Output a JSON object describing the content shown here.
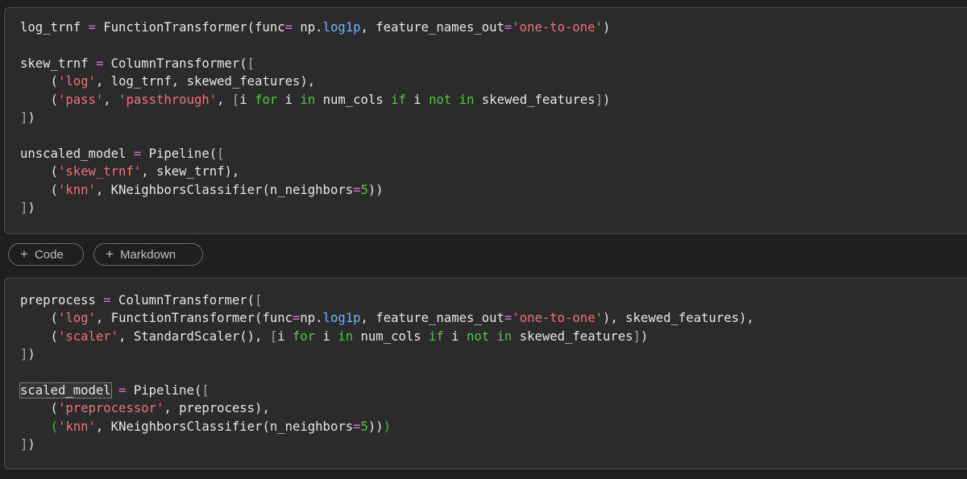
{
  "cells": [
    {
      "lines": [
        [
          [
            "n",
            "log_trnf "
          ],
          [
            "op",
            "="
          ],
          [
            "n",
            " FunctionTransformer(func"
          ],
          [
            "op",
            "="
          ],
          [
            "n",
            " np."
          ],
          [
            "attr",
            "log1p"
          ],
          [
            "n",
            ", feature_names_out"
          ],
          [
            "op",
            "="
          ],
          [
            "str",
            "'one-to-one'"
          ],
          [
            "n",
            ")"
          ]
        ],
        [],
        [
          [
            "n",
            "skew_trnf "
          ],
          [
            "op",
            "="
          ],
          [
            "n",
            " ColumnTransformer("
          ],
          [
            "brk",
            "["
          ]
        ],
        [
          [
            "n",
            "    ("
          ],
          [
            "str",
            "'log'"
          ],
          [
            "n",
            ", log_trnf, skewed_features),"
          ]
        ],
        [
          [
            "n",
            "    ("
          ],
          [
            "str",
            "'pass'"
          ],
          [
            "n",
            ", "
          ],
          [
            "str",
            "'passthrough'"
          ],
          [
            "n",
            ", "
          ],
          [
            "brk",
            "["
          ],
          [
            "n",
            "i "
          ],
          [
            "kw",
            "for"
          ],
          [
            "n",
            " i "
          ],
          [
            "kw",
            "in"
          ],
          [
            "n",
            " num_cols "
          ],
          [
            "kw",
            "if"
          ],
          [
            "n",
            " i "
          ],
          [
            "kw",
            "not"
          ],
          [
            "n",
            " "
          ],
          [
            "kw",
            "in"
          ],
          [
            "n",
            " skewed_features"
          ],
          [
            "brk",
            "]"
          ],
          [
            "n",
            ")"
          ]
        ],
        [
          [
            "brk",
            "]"
          ],
          [
            "n",
            ")"
          ]
        ],
        [],
        [
          [
            "n",
            "unscaled_model "
          ],
          [
            "op",
            "="
          ],
          [
            "n",
            " Pipeline("
          ],
          [
            "brk",
            "["
          ]
        ],
        [
          [
            "n",
            "    ("
          ],
          [
            "str",
            "'skew_trnf'"
          ],
          [
            "n",
            ", skew_trnf),"
          ]
        ],
        [
          [
            "n",
            "    ("
          ],
          [
            "str",
            "'knn'"
          ],
          [
            "n",
            ", KNeighborsClassifier(n_neighbors"
          ],
          [
            "op",
            "="
          ],
          [
            "kw",
            "5"
          ],
          [
            "n",
            "))"
          ]
        ],
        [
          [
            "brk",
            "]"
          ],
          [
            "n",
            ")"
          ]
        ]
      ]
    },
    {
      "lines": [
        [
          [
            "n",
            "preprocess "
          ],
          [
            "op",
            "="
          ],
          [
            "n",
            " ColumnTransformer("
          ],
          [
            "brk",
            "["
          ]
        ],
        [
          [
            "n",
            "    ("
          ],
          [
            "str",
            "'log'"
          ],
          [
            "n",
            ", FunctionTransformer(func"
          ],
          [
            "op",
            "="
          ],
          [
            "n",
            "np."
          ],
          [
            "attr",
            "log1p"
          ],
          [
            "n",
            ", feature_names_out"
          ],
          [
            "op",
            "="
          ],
          [
            "str",
            "'one-to-one'"
          ],
          [
            "n",
            "), skewed_features),"
          ]
        ],
        [
          [
            "n",
            "    ("
          ],
          [
            "str",
            "'scaler'"
          ],
          [
            "n",
            ", StandardScaler(), "
          ],
          [
            "brk",
            "["
          ],
          [
            "n",
            "i "
          ],
          [
            "kw",
            "for"
          ],
          [
            "n",
            " i "
          ],
          [
            "kw",
            "in"
          ],
          [
            "n",
            " num_cols "
          ],
          [
            "kw",
            "if"
          ],
          [
            "n",
            " i "
          ],
          [
            "kw",
            "not"
          ],
          [
            "n",
            " "
          ],
          [
            "kw",
            "in"
          ],
          [
            "n",
            " skewed_features"
          ],
          [
            "brk",
            "]"
          ],
          [
            "n",
            ")"
          ]
        ],
        [
          [
            "brk",
            "]"
          ],
          [
            "n",
            ")"
          ]
        ],
        [],
        [
          [
            "sel",
            "scaled_model"
          ],
          [
            "n",
            " "
          ],
          [
            "op",
            "="
          ],
          [
            "n",
            " Pipeline("
          ],
          [
            "brk",
            "["
          ]
        ],
        [
          [
            "n",
            "    ("
          ],
          [
            "str",
            "'preprocessor'"
          ],
          [
            "n",
            ", preprocess),"
          ]
        ],
        [
          [
            "n",
            "    "
          ],
          [
            "brk-g",
            "("
          ],
          [
            "str",
            "'knn'"
          ],
          [
            "n",
            ", KNeighborsClassifier(n_neighbors"
          ],
          [
            "op",
            "="
          ],
          [
            "kw",
            "5"
          ],
          [
            "n",
            "))"
          ],
          [
            "brk-g",
            ")"
          ]
        ],
        [
          [
            "brk",
            "]"
          ],
          [
            "n",
            ")"
          ]
        ]
      ]
    }
  ],
  "toolbar": {
    "plus": "+",
    "code_label": "Code",
    "markdown_label": "Markdown"
  }
}
